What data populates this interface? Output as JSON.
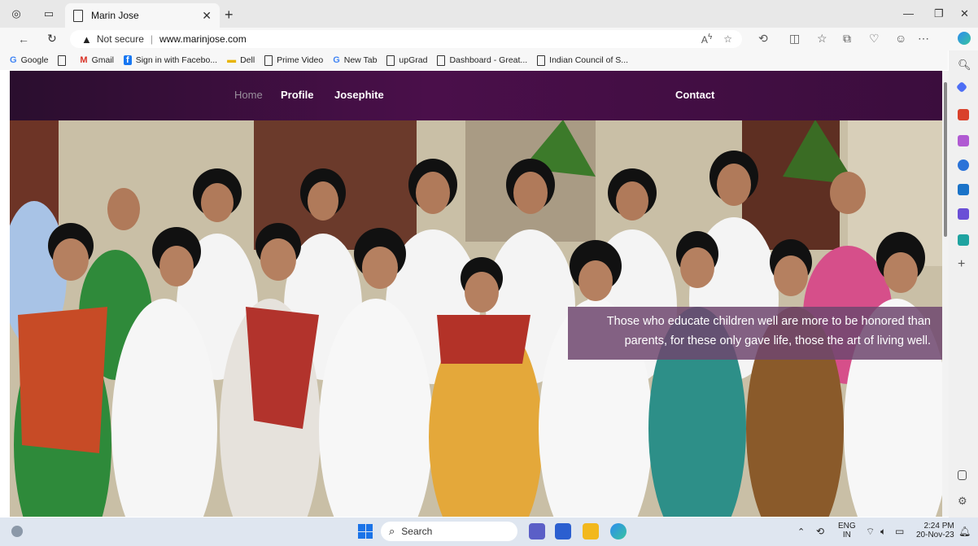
{
  "browser": {
    "tab_title": "Marin Jose",
    "address": {
      "security": "Not secure",
      "url": "www.marinjose.com"
    },
    "bookmarks": [
      {
        "label": "Google",
        "icon": "G"
      },
      {
        "label": "",
        "icon": "page"
      },
      {
        "label": "Gmail",
        "icon": "M"
      },
      {
        "label": "Sign in with Facebo...",
        "icon": "f"
      },
      {
        "label": "Dell",
        "icon": "folder"
      },
      {
        "label": "Prime Video",
        "icon": "page"
      },
      {
        "label": "New Tab",
        "icon": "G"
      },
      {
        "label": "upGrad",
        "icon": "page"
      },
      {
        "label": "Dashboard - Great...",
        "icon": "page"
      },
      {
        "label": "Indian Council of S...",
        "icon": "page"
      }
    ]
  },
  "site": {
    "nav": {
      "home": "Home",
      "profile": "Profile",
      "josephite": "Josephite",
      "contact": "Contact"
    },
    "quote_line1": "Those who educate children well are more to be honored than",
    "quote_line2": "parents, for these only gave life, those the art of living well."
  },
  "taskbar": {
    "search_placeholder": "Search",
    "lang_top": "ENG",
    "lang_bottom": "IN",
    "time": "2:24 PM",
    "date": "20-Nov-23"
  },
  "colors": {
    "nav_bg": "#3b0d3d",
    "quote_bg": "#6e466e",
    "taskbar_bg": "#dfe6f0"
  }
}
